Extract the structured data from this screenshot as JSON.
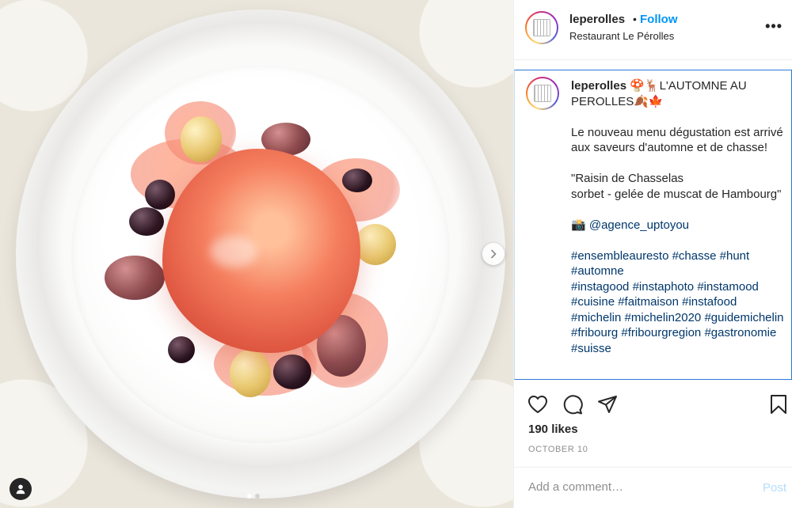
{
  "post": {
    "account": {
      "username": "leperolles",
      "separator": "•",
      "follow_label": "Follow",
      "location": "Restaurant Le Pérolles"
    },
    "more_label": "•••",
    "caption": {
      "username": "leperolles",
      "headline": "🍄🦌L'AUTOMNE AU PEROLLES🍂🍁",
      "paragraph1": "Le nouveau menu dégustation est arrivé aux saveurs d'automne et de chasse!",
      "dish_line1": "\"Raisin de Chasselas",
      "dish_line2": "sorbet - gelée de muscat de Hambourg\"",
      "credit_icon": "📸",
      "credit": "@agence_uptoyou",
      "hashtags": [
        "#ensembleauresto",
        "#chasse",
        "#hunt",
        "#automne",
        "#instagood",
        "#instaphoto",
        "#instamood",
        "#cuisine",
        "#faitmaison",
        "#instafood",
        "#michelin",
        "#michelin2020",
        "#guidemichelin",
        "#fribourg",
        "#fribourgregion",
        "#gastronomie",
        "#suisse"
      ]
    },
    "likes": "190 likes",
    "date": "OCTOBER 10",
    "comment": {
      "placeholder": "Add a comment…",
      "post_label": "Post"
    },
    "carousel": {
      "total_slides": 2,
      "active_slide": 1
    }
  },
  "colors": {
    "accent_blue": "#0095f6",
    "hashtag": "#00376b",
    "muted": "#8e8e8e",
    "post_disabled": "#b2dffc"
  }
}
